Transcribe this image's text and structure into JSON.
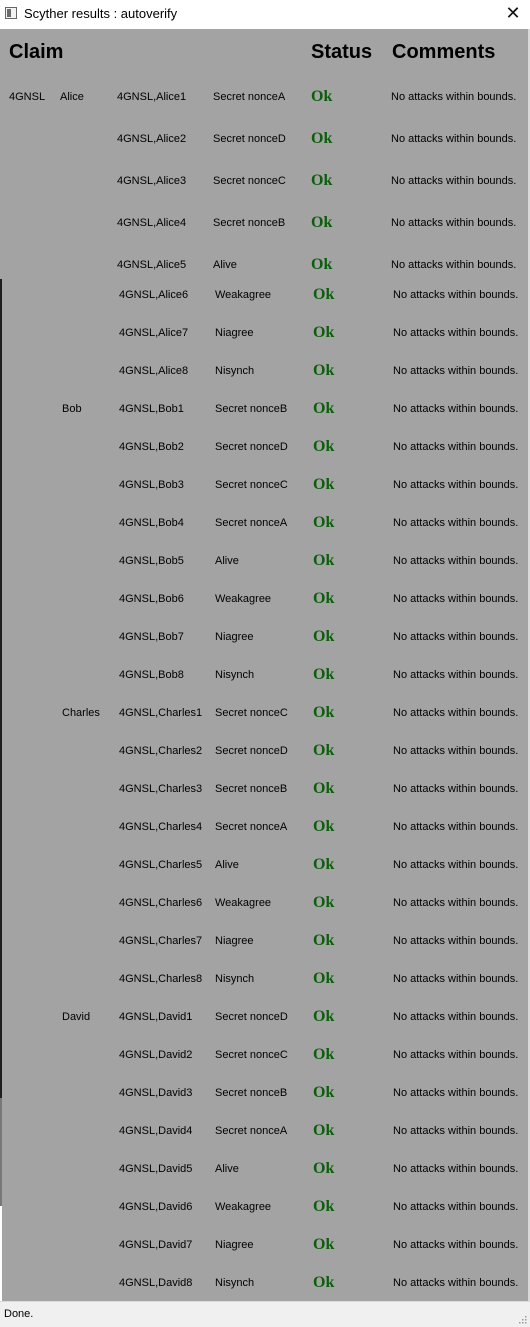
{
  "window": {
    "title": "Scyther results : autoverify",
    "close_icon": "✕"
  },
  "header": {
    "claim": "Claim",
    "status": "Status",
    "comments": "Comments"
  },
  "rows": [
    {
      "protocol": "4GNSL",
      "role": "Alice",
      "id": "4GNSL,Alice1",
      "claim": "Secret nonceA",
      "status": "Ok",
      "comment": "No attacks within bounds."
    },
    {
      "protocol": "",
      "role": "",
      "id": "4GNSL,Alice2",
      "claim": "Secret nonceD",
      "status": "Ok",
      "comment": "No attacks within bounds."
    },
    {
      "protocol": "",
      "role": "",
      "id": "4GNSL,Alice3",
      "claim": "Secret nonceC",
      "status": "Ok",
      "comment": "No attacks within bounds."
    },
    {
      "protocol": "",
      "role": "",
      "id": "4GNSL,Alice4",
      "claim": "Secret nonceB",
      "status": "Ok",
      "comment": "No attacks within bounds."
    },
    {
      "protocol": "",
      "role": "",
      "id": "4GNSL,Alice5",
      "claim": "Alive",
      "status": "Ok",
      "comment": "No attacks within bounds."
    },
    {
      "protocol": "",
      "role": "",
      "id": "4GNSL,Alice6",
      "claim": "Weakagree",
      "status": "Ok",
      "comment": "No attacks within bounds."
    },
    {
      "protocol": "",
      "role": "",
      "id": "4GNSL,Alice7",
      "claim": "Niagree",
      "status": "Ok",
      "comment": "No attacks within bounds."
    },
    {
      "protocol": "",
      "role": "",
      "id": "4GNSL,Alice8",
      "claim": "Nisynch",
      "status": "Ok",
      "comment": "No attacks within bounds."
    },
    {
      "protocol": "",
      "role": "Bob",
      "id": "4GNSL,Bob1",
      "claim": "Secret nonceB",
      "status": "Ok",
      "comment": "No attacks within bounds."
    },
    {
      "protocol": "",
      "role": "",
      "id": "4GNSL,Bob2",
      "claim": "Secret nonceD",
      "status": "Ok",
      "comment": "No attacks within bounds."
    },
    {
      "protocol": "",
      "role": "",
      "id": "4GNSL,Bob3",
      "claim": "Secret nonceC",
      "status": "Ok",
      "comment": "No attacks within bounds."
    },
    {
      "protocol": "",
      "role": "",
      "id": "4GNSL,Bob4",
      "claim": "Secret nonceA",
      "status": "Ok",
      "comment": "No attacks within bounds."
    },
    {
      "protocol": "",
      "role": "",
      "id": "4GNSL,Bob5",
      "claim": "Alive",
      "status": "Ok",
      "comment": "No attacks within bounds."
    },
    {
      "protocol": "",
      "role": "",
      "id": "4GNSL,Bob6",
      "claim": "Weakagree",
      "status": "Ok",
      "comment": "No attacks within bounds."
    },
    {
      "protocol": "",
      "role": "",
      "id": "4GNSL,Bob7",
      "claim": "Niagree",
      "status": "Ok",
      "comment": "No attacks within bounds."
    },
    {
      "protocol": "",
      "role": "",
      "id": "4GNSL,Bob8",
      "claim": "Nisynch",
      "status": "Ok",
      "comment": "No attacks within bounds."
    },
    {
      "protocol": "",
      "role": "Charles",
      "id": "4GNSL,Charles1",
      "claim": "Secret nonceC",
      "status": "Ok",
      "comment": "No attacks within bounds."
    },
    {
      "protocol": "",
      "role": "",
      "id": "4GNSL,Charles2",
      "claim": "Secret nonceD",
      "status": "Ok",
      "comment": "No attacks within bounds."
    },
    {
      "protocol": "",
      "role": "",
      "id": "4GNSL,Charles3",
      "claim": "Secret nonceB",
      "status": "Ok",
      "comment": "No attacks within bounds."
    },
    {
      "protocol": "",
      "role": "",
      "id": "4GNSL,Charles4",
      "claim": "Secret nonceA",
      "status": "Ok",
      "comment": "No attacks within bounds."
    },
    {
      "protocol": "",
      "role": "",
      "id": "4GNSL,Charles5",
      "claim": "Alive",
      "status": "Ok",
      "comment": "No attacks within bounds."
    },
    {
      "protocol": "",
      "role": "",
      "id": "4GNSL,Charles6",
      "claim": "Weakagree",
      "status": "Ok",
      "comment": "No attacks within bounds."
    },
    {
      "protocol": "",
      "role": "",
      "id": "4GNSL,Charles7",
      "claim": "Niagree",
      "status": "Ok",
      "comment": "No attacks within bounds."
    },
    {
      "protocol": "",
      "role": "",
      "id": "4GNSL,Charles8",
      "claim": "Nisynch",
      "status": "Ok",
      "comment": "No attacks within bounds."
    },
    {
      "protocol": "",
      "role": "David",
      "id": "4GNSL,David1",
      "claim": "Secret nonceD",
      "status": "Ok",
      "comment": "No attacks within bounds."
    },
    {
      "protocol": "",
      "role": "",
      "id": "4GNSL,David2",
      "claim": "Secret nonceC",
      "status": "Ok",
      "comment": "No attacks within bounds."
    },
    {
      "protocol": "",
      "role": "",
      "id": "4GNSL,David3",
      "claim": "Secret nonceB",
      "status": "Ok",
      "comment": "No attacks within bounds."
    },
    {
      "protocol": "",
      "role": "",
      "id": "4GNSL,David4",
      "claim": "Secret nonceA",
      "status": "Ok",
      "comment": "No attacks within bounds."
    },
    {
      "protocol": "",
      "role": "",
      "id": "4GNSL,David5",
      "claim": "Alive",
      "status": "Ok",
      "comment": "No attacks within bounds."
    },
    {
      "protocol": "",
      "role": "",
      "id": "4GNSL,David6",
      "claim": "Weakagree",
      "status": "Ok",
      "comment": "No attacks within bounds."
    },
    {
      "protocol": "",
      "role": "",
      "id": "4GNSL,David7",
      "claim": "Niagree",
      "status": "Ok",
      "comment": "No attacks within bounds."
    },
    {
      "protocol": "",
      "role": "",
      "id": "4GNSL,David8",
      "claim": "Nisynch",
      "status": "Ok",
      "comment": "No attacks within bounds."
    }
  ],
  "statusbar": {
    "text": "Done."
  },
  "colors": {
    "panel_background": "#a3a3a3",
    "ok_status": "#0c5e0c"
  }
}
